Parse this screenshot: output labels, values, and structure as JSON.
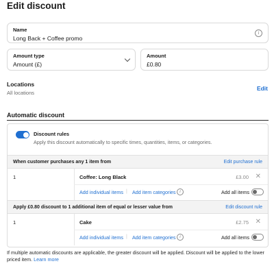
{
  "page": {
    "title": "Edit discount"
  },
  "name_field": {
    "label": "Name",
    "value": "Long Back + Coffee promo",
    "icon": "info-icon"
  },
  "amount_type_field": {
    "label": "Amount type",
    "value": "Amount (£)",
    "icon": "chevron-down-icon"
  },
  "amount_field": {
    "label": "Amount",
    "value": "£0.80"
  },
  "locations": {
    "title": "Locations",
    "subtitle": "All locations",
    "edit_label": "Edit"
  },
  "automatic_discount": {
    "section_title": "Automatic discount",
    "rules_toggle_on": true,
    "rules_title": "Discount rules",
    "rules_description": "Apply this discount automatically to specific times, quantities, items, or categories."
  },
  "groups": [
    {
      "header": "When customer purchases any 1 item from",
      "edit_link": "Edit purchase rule",
      "quantity": "1",
      "item_name": "Coffee: Long Black",
      "price": "£3.00",
      "add_items_link": "Add individual items",
      "add_categories_link": "Add item categories",
      "separator": "|",
      "add_all_label": "Add all items",
      "add_all_on": false
    },
    {
      "header": "Apply £0.80 discount to 1 additional item of equal or lesser value from",
      "edit_link": "Edit discount rule",
      "quantity": "1",
      "item_name": "Cake",
      "price": "£2.75",
      "add_items_link": "Add individual items",
      "add_categories_link": "Add item categories",
      "separator": "|",
      "add_all_label": "Add all items",
      "add_all_on": false
    }
  ],
  "footer": {
    "text": "If multiple automatic discounts are applicable, the greater discount will be applied. Discount will be applied to the lower priced item. ",
    "link": "Learn more"
  },
  "colors": {
    "accent": "#1f6fd1",
    "header_bg": "#f3f3f3",
    "border": "#d9d9d9"
  }
}
